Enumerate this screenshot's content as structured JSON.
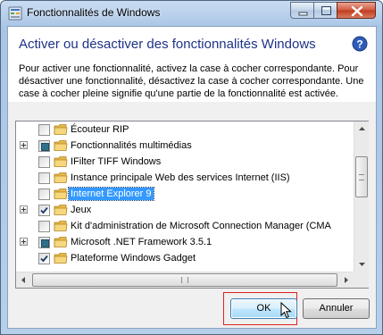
{
  "window": {
    "title": "Fonctionnalités de Windows"
  },
  "header": {
    "title": "Activer ou désactiver des fonctionnalités Windows",
    "description": "Pour activer une fonctionnalité, activez la case à cocher correspondante. Pour désactiver une fonctionnalité, désactivez la case à cocher correspondante. Une case à cocher pleine signifie qu'une partie de la fonctionnalité est activée."
  },
  "features": [
    {
      "label": "Écouteur RIP",
      "expandable": false,
      "state": "unchecked",
      "selected": false
    },
    {
      "label": "Fonctionnalités multimédias",
      "expandable": true,
      "state": "partial",
      "selected": false
    },
    {
      "label": "IFilter TIFF Windows",
      "expandable": false,
      "state": "unchecked",
      "selected": false
    },
    {
      "label": "Instance principale Web des services Internet (IIS)",
      "expandable": false,
      "state": "unchecked",
      "selected": false
    },
    {
      "label": "Internet Explorer 9",
      "expandable": false,
      "state": "unchecked",
      "selected": true
    },
    {
      "label": "Jeux",
      "expandable": true,
      "state": "checked",
      "selected": false
    },
    {
      "label": "Kit d'administration de Microsoft Connection Manager (CMA",
      "expandable": false,
      "state": "unchecked",
      "selected": false
    },
    {
      "label": "Microsoft .NET Framework 3.5.1",
      "expandable": true,
      "state": "partial",
      "selected": false
    },
    {
      "label": "Plateforme Windows Gadget",
      "expandable": false,
      "state": "checked",
      "selected": false
    }
  ],
  "buttons": {
    "ok": "OK",
    "cancel": "Annuler"
  },
  "colors": {
    "title_blue": "#1e3287",
    "selection": "#3399ff",
    "highlight_box": "#dd2222"
  },
  "icons": [
    "app-icon",
    "minimize-icon",
    "maximize-icon",
    "close-icon",
    "help-icon",
    "folder-icon",
    "mouse-cursor-icon"
  ]
}
